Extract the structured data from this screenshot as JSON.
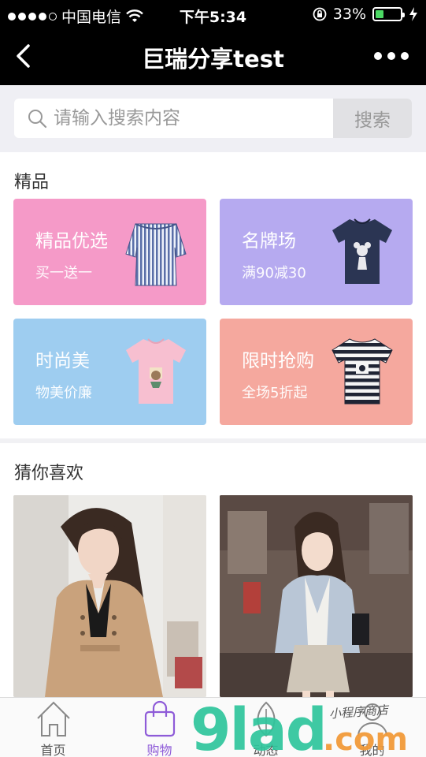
{
  "status": {
    "carrier": "中国电信",
    "time": "下午5:34",
    "battery": "33%",
    "battery_level": 0.33
  },
  "nav": {
    "title": "巨瑞分享test"
  },
  "search": {
    "placeholder": "请输入搜索内容",
    "button": "搜索"
  },
  "premium": {
    "title": "精品",
    "cards": [
      {
        "title": "精品优选",
        "sub": "买一送一",
        "color": "#f59ac8"
      },
      {
        "title": "名牌场",
        "sub": "满90减30",
        "color": "#b6aaf0"
      },
      {
        "title": "时尚美",
        "sub": "物美价廉",
        "color": "#9ecdf0"
      },
      {
        "title": "限时抢购",
        "sub": "全场5折起",
        "color": "#f5a89e"
      }
    ]
  },
  "guess": {
    "title": "猜你喜欢"
  },
  "tabs": [
    {
      "label": "首页",
      "icon": "home-icon"
    },
    {
      "label": "购物",
      "icon": "shopping-bag-icon",
      "active": true
    },
    {
      "label": "动态",
      "icon": "leaf-icon"
    },
    {
      "label": "我的",
      "icon": "user-icon"
    }
  ],
  "watermark": {
    "text": "9lad.com",
    "sub": "小程序商店"
  },
  "colors": {
    "accent": "#8e5bd8",
    "navbar": "#000000"
  }
}
